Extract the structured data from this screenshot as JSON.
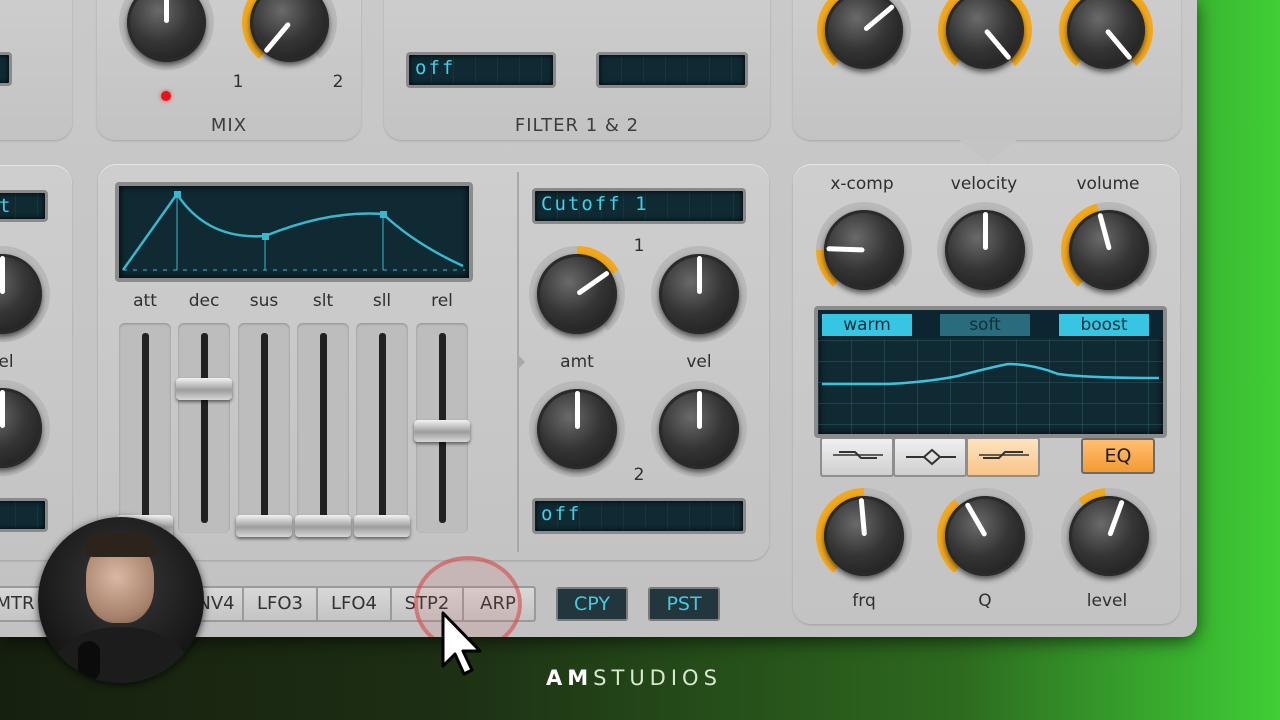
{
  "mix": {
    "label": "MIX",
    "knob1_label": "1",
    "knob2_label": "2"
  },
  "filter": {
    "label": "FILTER 1 & 2",
    "display1": "off",
    "display2": ""
  },
  "envelope": {
    "params": [
      "att",
      "dec",
      "sus",
      "slt",
      "sll",
      "rel"
    ]
  },
  "mod": {
    "destination1": "Cutoff 1",
    "slot1_number": "1",
    "slot2_number": "2",
    "amt_label": "amt",
    "vel_label": "vel",
    "destination2": "off"
  },
  "left_partial": {
    "top_display": "t",
    "bottom_display": "",
    "knob_label": "el"
  },
  "output": {
    "xcomp_label": "x-comp",
    "velocity_label": "velocity",
    "volume_label": "volume",
    "chips": [
      "warm",
      "soft",
      "boost"
    ],
    "shape_buttons": [
      "low-shelf",
      "peak",
      "high-shelf"
    ],
    "shape_glyphs": [
      "⊸",
      "⟡",
      "⟜"
    ],
    "eq_button": "EQ",
    "frq_label": "frq",
    "q_label": "Q",
    "level_label": "level"
  },
  "tabs": [
    "MTR",
    "NV4",
    "LFO3",
    "LFO4",
    "STP2",
    "ARP"
  ],
  "copy_button": "CPY",
  "paste_button": "PST",
  "watermark": {
    "bold": "AM",
    "light": "STUDIOS"
  },
  "colors": {
    "accent": "#f2a81d",
    "lcd_text": "#3fd0ea",
    "eq_button": "#f6a23a"
  }
}
